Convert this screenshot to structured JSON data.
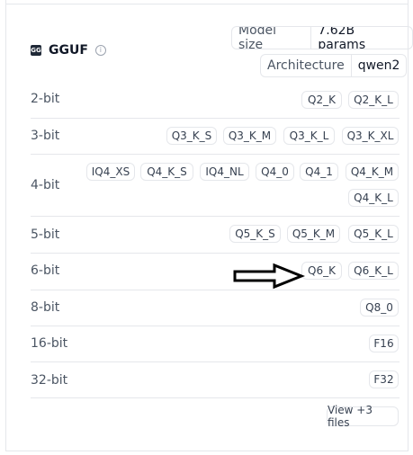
{
  "header": {
    "icon_text": "GG",
    "title": "GGUF",
    "info_icon": "info-icon"
  },
  "meta": [
    {
      "label": "Model size",
      "value": "7.62B params"
    },
    {
      "label": "Architecture",
      "value": "qwen2"
    }
  ],
  "rows": [
    {
      "bits": "2-bit",
      "tags": [
        "Q2_K",
        "Q2_K_L"
      ]
    },
    {
      "bits": "3-bit",
      "tags": [
        "Q3_K_S",
        "Q3_K_M",
        "Q3_K_L",
        "Q3_K_XL"
      ]
    },
    {
      "bits": "4-bit",
      "tags": [
        "IQ4_XS",
        "Q4_K_S",
        "IQ4_NL",
        "Q4_0",
        "Q4_1",
        "Q4_K_M",
        "Q4_K_L"
      ]
    },
    {
      "bits": "5-bit",
      "tags": [
        "Q5_K_S",
        "Q5_K_M",
        "Q5_K_L"
      ]
    },
    {
      "bits": "6-bit",
      "tags": [
        "Q6_K",
        "Q6_K_L"
      ]
    },
    {
      "bits": "8-bit",
      "tags": [
        "Q8_0"
      ]
    },
    {
      "bits": "16-bit",
      "tags": [
        "F16"
      ]
    },
    {
      "bits": "32-bit",
      "tags": [
        "F32"
      ]
    }
  ],
  "footer": {
    "view_more": "View +3 files"
  },
  "annotation": {
    "arrow_icon": "right-arrow-icon",
    "color": "#000000"
  }
}
